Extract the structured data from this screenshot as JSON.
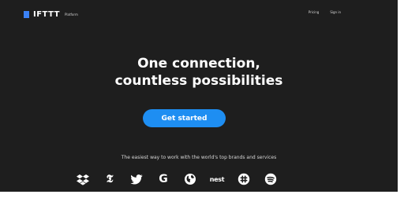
{
  "header": {
    "logo_text": "IFTTT",
    "logo_sub": "Platform",
    "nav": [
      "Pricing",
      "Sign in"
    ]
  },
  "hero": {
    "title_line1": "One connection,",
    "title_line2": "countless possibilities",
    "cta_label": "Get started"
  },
  "tagline": "The easiest way to work with the world's top brands and services",
  "brands": [
    {
      "name": "dropbox",
      "icon": "dropbox-icon"
    },
    {
      "name": "new york times",
      "icon": "nyt-icon",
      "glyph": "𝕿"
    },
    {
      "name": "twitter",
      "icon": "twitter-icon"
    },
    {
      "name": "google",
      "icon": "google-icon",
      "glyph": "G"
    },
    {
      "name": "earth",
      "icon": "globe-icon"
    },
    {
      "name": "nest",
      "icon": "nest-icon",
      "glyph": "nest"
    },
    {
      "name": "slack",
      "icon": "slack-icon"
    },
    {
      "name": "spotify",
      "icon": "spotify-icon"
    }
  ],
  "colors": {
    "background": "#1e1e1e",
    "accent": "#1e8ef2",
    "logo_mark": "#3b82f6"
  }
}
